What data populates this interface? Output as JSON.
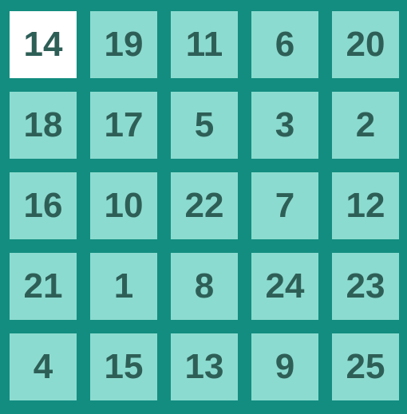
{
  "board": {
    "colors": {
      "background": "#138d80",
      "tile": "#8cdbd0",
      "tile_selected": "#ffffff",
      "text": "#2e5f57"
    },
    "rows": [
      [
        {
          "value": "14",
          "selected": true
        },
        {
          "value": "19",
          "selected": false
        },
        {
          "value": "11",
          "selected": false
        },
        {
          "value": "6",
          "selected": false
        },
        {
          "value": "20",
          "selected": false
        }
      ],
      [
        {
          "value": "18",
          "selected": false
        },
        {
          "value": "17",
          "selected": false
        },
        {
          "value": "5",
          "selected": false
        },
        {
          "value": "3",
          "selected": false
        },
        {
          "value": "2",
          "selected": false
        }
      ],
      [
        {
          "value": "16",
          "selected": false
        },
        {
          "value": "10",
          "selected": false
        },
        {
          "value": "22",
          "selected": false
        },
        {
          "value": "7",
          "selected": false
        },
        {
          "value": "12",
          "selected": false
        }
      ],
      [
        {
          "value": "21",
          "selected": false
        },
        {
          "value": "1",
          "selected": false
        },
        {
          "value": "8",
          "selected": false
        },
        {
          "value": "24",
          "selected": false
        },
        {
          "value": "23",
          "selected": false
        }
      ],
      [
        {
          "value": "4",
          "selected": false
        },
        {
          "value": "15",
          "selected": false
        },
        {
          "value": "13",
          "selected": false
        },
        {
          "value": "9",
          "selected": false
        },
        {
          "value": "25",
          "selected": false
        }
      ]
    ]
  }
}
